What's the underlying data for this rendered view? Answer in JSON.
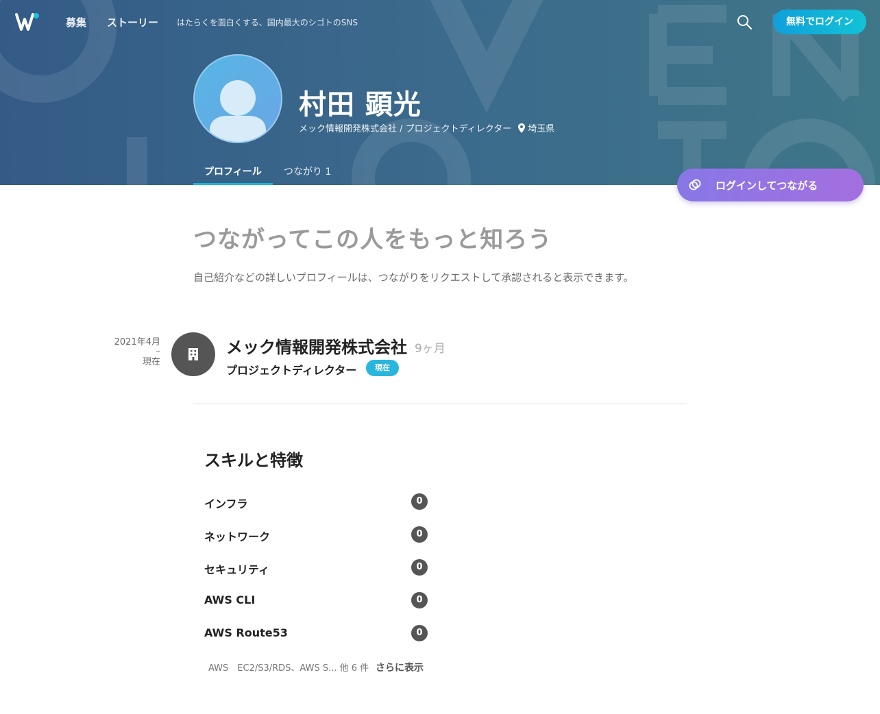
{
  "nav": {
    "links": [
      "募集",
      "ストーリー"
    ],
    "tagline": "はたらくを面白くする、国内最大のシゴトのSNS",
    "login_label": "無料でログイン"
  },
  "profile": {
    "name": "村田 顕光",
    "company_role": "メック情報開発株式会社 / プロジェクトディレクター",
    "location": "埼玉県"
  },
  "tabs": [
    {
      "label": "プロフィール",
      "active": true
    },
    {
      "label": "つながり 1",
      "active": false
    }
  ],
  "connect_button": "ログインしてつながる",
  "cta": {
    "title": "つながってこの人をもっと知ろう",
    "description": "自己紹介などの詳しいプロフィールは、つながりをリクエストして承認されると表示できます。"
  },
  "experience": {
    "start": "2021年4月",
    "dash": "–",
    "end": "現在",
    "company": "メック情報開発株式会社",
    "duration": "9ヶ月",
    "role": "プロジェクトディレクター",
    "badge": "現在"
  },
  "skills": {
    "title": "スキルと特徴",
    "items": [
      {
        "name": "インフラ",
        "count": "0"
      },
      {
        "name": "ネットワーク",
        "count": "0"
      },
      {
        "name": "セキュリティ",
        "count": "0"
      },
      {
        "name": "AWS CLI",
        "count": "0"
      },
      {
        "name": "AWS Route53",
        "count": "0"
      }
    ],
    "more_text": "AWS　EC2/S3/RDS、AWS S... 他 6 件",
    "more_link": "さらに表示"
  },
  "colors": {
    "hero": "#3a6589",
    "accent": "#21b6d8",
    "connect": "#9672e3"
  }
}
